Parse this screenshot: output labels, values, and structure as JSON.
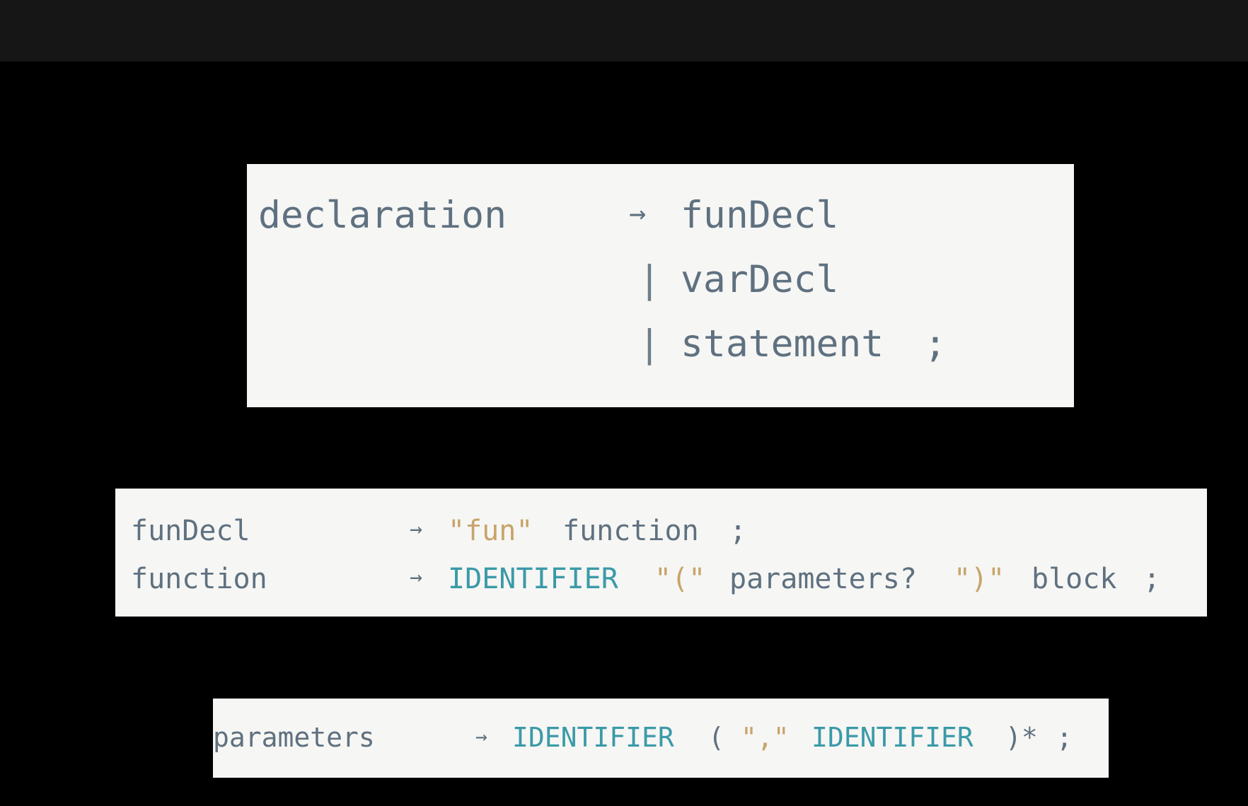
{
  "colors": {
    "background": "#000000",
    "top_bar": "#161616",
    "panel": "#f6f6f4",
    "nonterminal": "#5f7180",
    "string_literal": "#c7a46a",
    "token": "#3a9aa8"
  },
  "declaration_rule": {
    "name": "declaration",
    "arrow": "→",
    "alt1": "funDecl",
    "pipe1": "|",
    "alt2": "varDecl",
    "pipe2": "|",
    "alt3": "statement",
    "semicolon": ";"
  },
  "fundecl_rule": {
    "name": "funDecl",
    "arrow": "→",
    "literal": "\"fun\"",
    "ref": "function",
    "semicolon": ";"
  },
  "function_rule": {
    "name": "function",
    "arrow": "→",
    "token": "IDENTIFIER",
    "open_paren": "\"(\"",
    "params": "parameters?",
    "close_paren": "\")\"",
    "block": "block",
    "semicolon": ";"
  },
  "parameters_rule": {
    "name": "parameters",
    "arrow": "→",
    "token1": "IDENTIFIER",
    "group_open": "(",
    "comma": "\",\"",
    "token2": "IDENTIFIER",
    "group_close": ")*",
    "semicolon": ";"
  }
}
